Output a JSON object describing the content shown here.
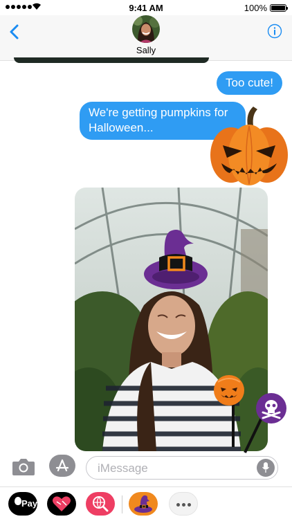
{
  "status_bar": {
    "time": "9:41 AM",
    "battery_percent": "100%",
    "signal_bars": 5
  },
  "header": {
    "contact_name": "Sally",
    "back_icon": "chevron-left-icon",
    "info_icon": "info-circle-icon"
  },
  "messages": [
    {
      "sender": "me",
      "text": "Too cute!"
    },
    {
      "sender": "me",
      "text": "We're getting pumpkins for Halloween..."
    }
  ],
  "stickers": [
    "jack-o-lantern",
    "witch-hat",
    "pumpkin-lollipop",
    "skull-lollipop"
  ],
  "input": {
    "placeholder": "iMessage",
    "value": ""
  },
  "app_drawer": {
    "items": [
      {
        "name": "apple-pay",
        "label": "Pay"
      },
      {
        "name": "digital-touch"
      },
      {
        "name": "images-search"
      },
      {
        "name": "halloween-stickers"
      },
      {
        "name": "more"
      }
    ]
  },
  "colors": {
    "accent": "#1a8cf2",
    "bubble": "#2f9cf3",
    "pumpkin": "#f07d1a",
    "hat": "#6b2e93"
  }
}
